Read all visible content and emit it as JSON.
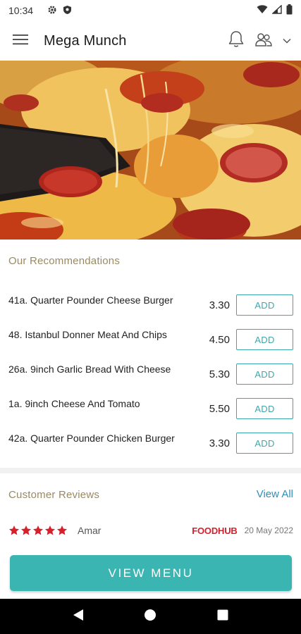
{
  "status_bar": {
    "time": "10:34",
    "icons": [
      "gear-icon",
      "shield-icon",
      "wifi-icon",
      "signal-icon",
      "battery-icon"
    ]
  },
  "app_bar": {
    "title": "Mega Munch",
    "icons": [
      "menu-icon",
      "bell-icon",
      "users-icon",
      "chevron-down-icon"
    ]
  },
  "hero": {
    "image": "pizza-photo"
  },
  "recommendations": {
    "title": "Our Recommendations",
    "items": [
      {
        "name": "41a. Quarter Pounder Cheese Burger",
        "price": "3.30",
        "button": "ADD"
      },
      {
        "name": "48. Istanbul Donner Meat And Chips",
        "price": "4.50",
        "button": "ADD"
      },
      {
        "name": "26a. 9inch Garlic Bread With Cheese",
        "price": "5.30",
        "button": "ADD"
      },
      {
        "name": "1a. 9inch Cheese And Tomato",
        "price": "5.50",
        "button": "ADD"
      },
      {
        "name": "42a. Quarter Pounder Chicken Burger",
        "price": "3.30",
        "button": "ADD"
      }
    ]
  },
  "reviews": {
    "title": "Customer Reviews",
    "view_all": "View All",
    "items": [
      {
        "rating": 5,
        "name": "Amar",
        "source": "FOODHUB",
        "date": "20 May 2022"
      }
    ]
  },
  "cta": {
    "label": "VIEW MENU"
  },
  "nav": {
    "icons": [
      "back-icon",
      "home-icon",
      "recents-icon"
    ]
  },
  "colors": {
    "accent": "#3ab5b2",
    "section_title": "#9a8a63",
    "link": "#2f8fb8",
    "star": "#d6202b",
    "foodhub": "#d6202b"
  }
}
